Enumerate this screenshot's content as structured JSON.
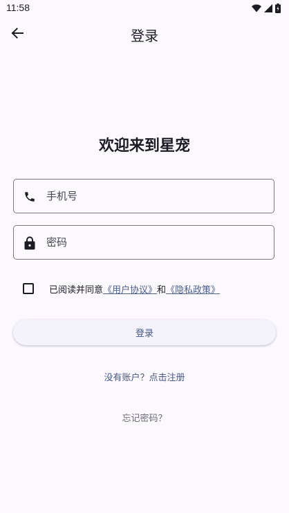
{
  "status_bar": {
    "time": "11:58",
    "icons": [
      "wifi-icon",
      "cell-signal-icon",
      "battery-icon"
    ]
  },
  "app_bar": {
    "title": "登录",
    "back_icon": "arrow-back-icon"
  },
  "welcome": {
    "title": "欢迎来到星宠"
  },
  "form": {
    "phone": {
      "icon": "phone-icon",
      "placeholder": "手机号",
      "value": ""
    },
    "password": {
      "icon": "lock-icon",
      "placeholder": "密码",
      "value": ""
    }
  },
  "agreement": {
    "checked": false,
    "prefix": "已阅读并同意",
    "user_agreement": "《用户协议》",
    "conjunction": "和",
    "privacy_policy": "《隐私政策》"
  },
  "actions": {
    "login_label": "登录",
    "register_label": "没有账户？点击注册",
    "forgot_label": "忘记密码？"
  },
  "colors": {
    "background": "#fbf8ff",
    "accent": "#45578a",
    "outline": "#77767f"
  }
}
